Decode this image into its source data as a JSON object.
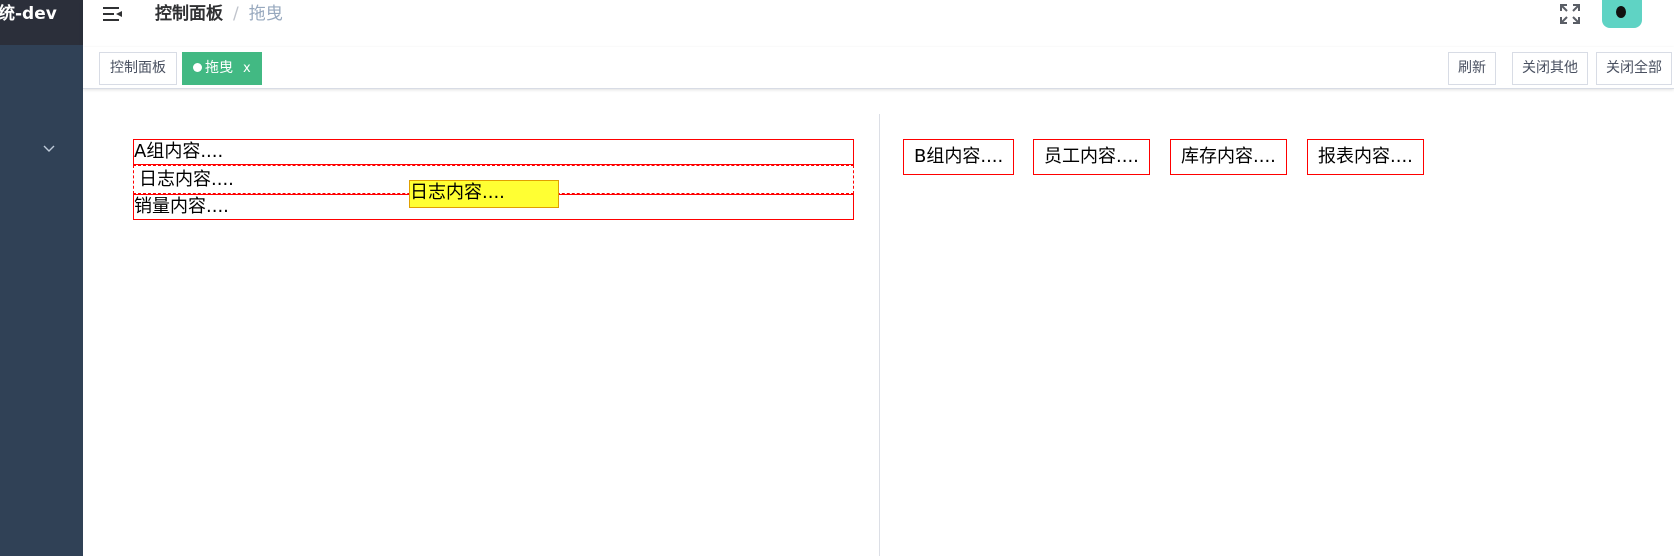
{
  "sidebar": {
    "title": "统-dev",
    "chevron_icon": "chevron-down-icon"
  },
  "navbar": {
    "hamburger_icon": "menu-fold-icon",
    "breadcrumb": {
      "home": "控制面板",
      "separator": "/",
      "current": "拖曳"
    },
    "fullscreen_icon": "fullscreen-icon",
    "avatar_icon": "avatar-icon"
  },
  "tags": {
    "items": [
      {
        "label": "控制面板",
        "active": false
      },
      {
        "label": "拖曳",
        "active": true,
        "close": "x"
      }
    ],
    "actions": [
      "刷新",
      "关闭其他",
      "关闭全部"
    ]
  },
  "group_a": {
    "items": [
      "A组内容....",
      "日志内容....",
      "销量内容...."
    ],
    "dragging": "日志内容...."
  },
  "group_b": {
    "items": [
      "B组内容....",
      "员工内容....",
      "库存内容....",
      "报表内容...."
    ]
  },
  "colors": {
    "sidebar": "#304156",
    "logo_bg": "#2b2f3a",
    "active_tag": "#42b983",
    "item_border": "#ff0000",
    "drag_ghost": "#ffff33",
    "avatar": "#5fd3c4"
  }
}
